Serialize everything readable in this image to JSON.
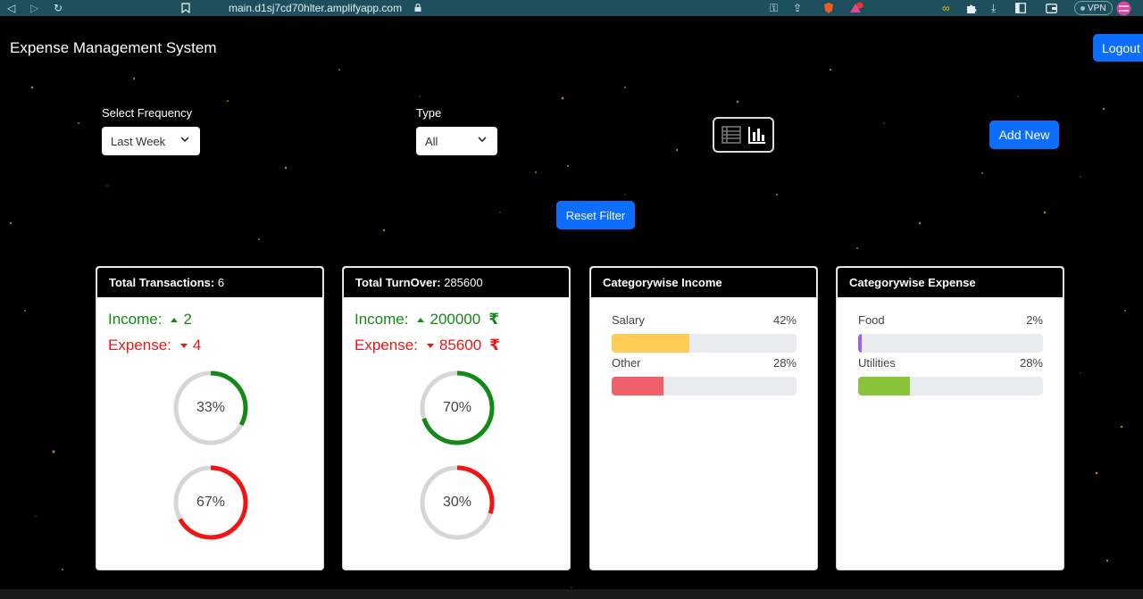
{
  "browser": {
    "url": "main.d1sj7cd70hlter.amplifyapp.com",
    "vpn_label": "VPN"
  },
  "header": {
    "title": "Expense Management System",
    "logout_label": "Logout"
  },
  "filters": {
    "frequency_label": "Select Frequency",
    "frequency_value": "Last Week",
    "type_label": "Type",
    "type_value": "All",
    "add_new_label": "Add New",
    "reset_label": "Reset Filter"
  },
  "colors": {
    "income": "#128a16",
    "expense": "#f01414",
    "primary": "#0d6efd",
    "salary": "#ffcd56",
    "other": "#f0606a",
    "food": "#9a62f0",
    "utilities": "#8ac43a"
  },
  "cards": {
    "transactions": {
      "title_bold": "Total Transactions:",
      "title_value": "6",
      "income_label": "Income:",
      "income_value": "2",
      "expense_label": "Expense:",
      "expense_value": "4",
      "income_pct": 33,
      "income_pct_label": "33%",
      "expense_pct": 67,
      "expense_pct_label": "67%"
    },
    "turnover": {
      "title_bold": "Total TurnOver:",
      "title_value": "285600",
      "income_label": "Income:",
      "income_value": "200000",
      "expense_label": "Expense:",
      "expense_value": "85600",
      "currency": "₹",
      "income_pct": 70,
      "income_pct_label": "70%",
      "expense_pct": 30,
      "expense_pct_label": "30%"
    },
    "income_categories": {
      "title": "Categorywise Income",
      "items": [
        {
          "name": "Salary",
          "pct_label": "42%",
          "pct": 42
        },
        {
          "name": "Other",
          "pct_label": "28%",
          "pct": 28
        }
      ]
    },
    "expense_categories": {
      "title": "Categorywise Expense",
      "items": [
        {
          "name": "Food",
          "pct_label": "2%",
          "pct": 2
        },
        {
          "name": "Utilities",
          "pct_label": "28%",
          "pct": 28
        }
      ]
    }
  }
}
